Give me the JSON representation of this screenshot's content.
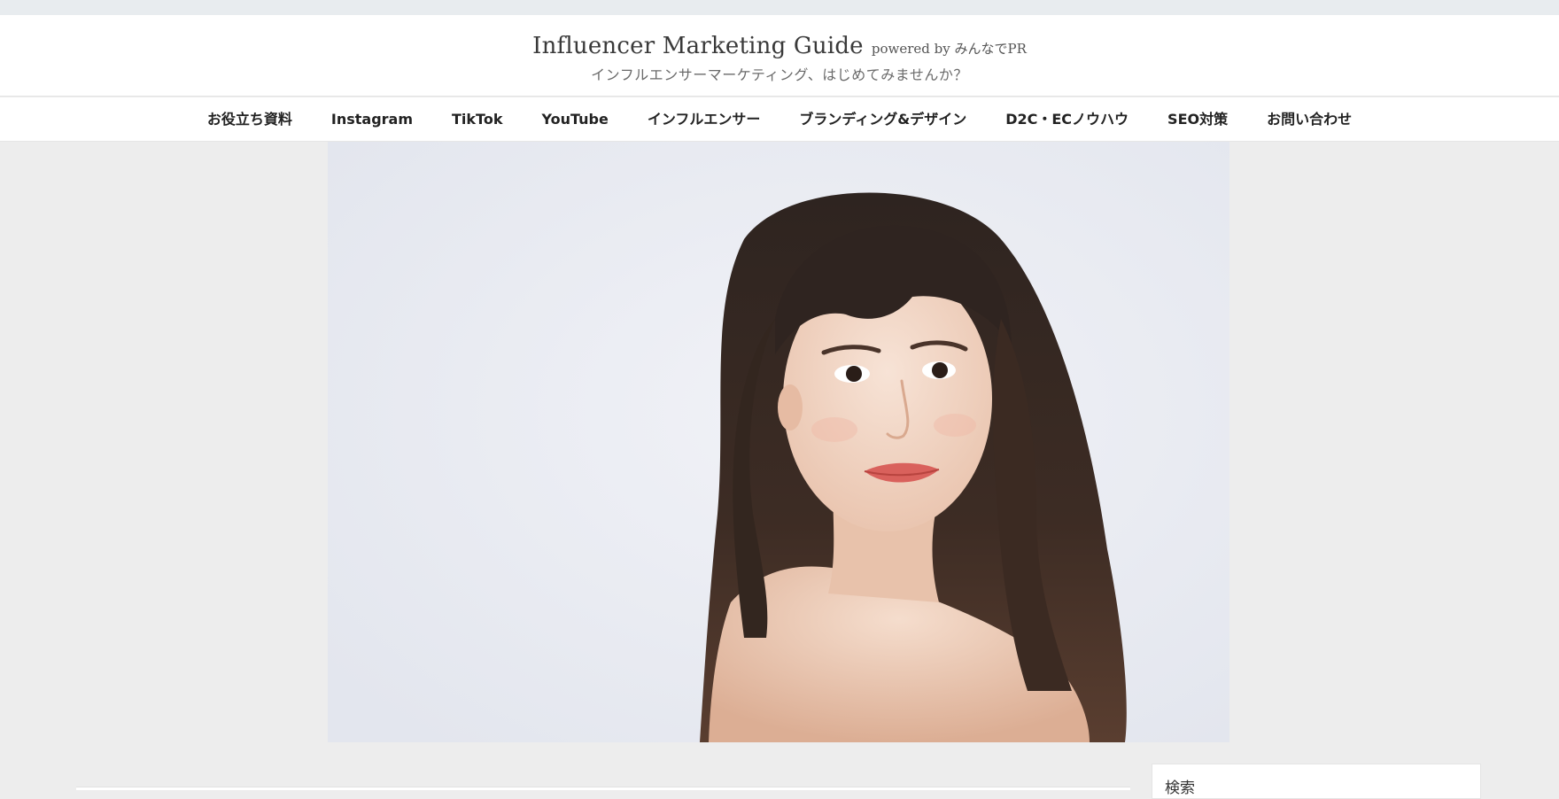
{
  "site": {
    "title": "Influencer Marketing Guide",
    "powered_by": "powered by みんなでPR",
    "tagline": "インフルエンサーマーケティング、はじめてみませんか？"
  },
  "nav": {
    "items": [
      {
        "label": "お役立ち資料"
      },
      {
        "label": "Instagram"
      },
      {
        "label": "TikTok"
      },
      {
        "label": "YouTube"
      },
      {
        "label": "インフルエンサー"
      },
      {
        "label": "ブランディング&デザイン"
      },
      {
        "label": "D2C・ECノウハウ"
      },
      {
        "label": "SEO対策"
      },
      {
        "label": "お問い合わせ"
      }
    ]
  },
  "sidebar": {
    "search_label": "検索"
  },
  "colors": {
    "page_background": "#ededed",
    "header_background": "#ffffff",
    "nav_text": "#222222",
    "title_text": "#3a3a3a",
    "hero_background": "#e8eaf2"
  }
}
